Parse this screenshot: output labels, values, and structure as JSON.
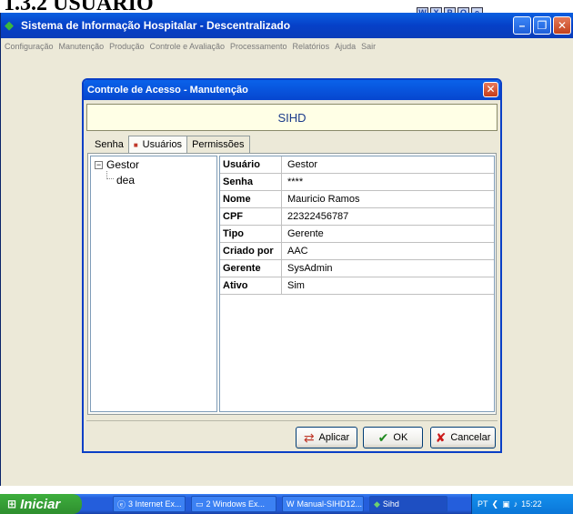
{
  "doc_heading": "1.3.2 USUÁRIO",
  "top_icons": [
    "W",
    "X",
    "P",
    "O",
    "e"
  ],
  "app": {
    "title": "Sistema de Informação Hospitalar - Descentralizado",
    "menu": [
      "Configuração",
      "Manutenção",
      "Produção",
      "Controle e Avaliação",
      "Processamento",
      "Relatórios",
      "Ajuda",
      "Sair"
    ]
  },
  "dialog": {
    "title": "Controle de Acesso - Manutenção",
    "banner": "SIHD",
    "tabs": [
      "Senha",
      "Usuários",
      "Permissões"
    ],
    "active_tab": "Usuários",
    "tree": {
      "root": "Gestor",
      "children": [
        "dea"
      ]
    },
    "properties": [
      {
        "key": "Usuário",
        "value": "Gestor"
      },
      {
        "key": "Senha",
        "value": "****"
      },
      {
        "key": "Nome",
        "value": "Mauricio Ramos"
      },
      {
        "key": "CPF",
        "value": "22322456787"
      },
      {
        "key": "Tipo",
        "value": "Gerente"
      },
      {
        "key": "Criado por",
        "value": "AAC"
      },
      {
        "key": "Gerente",
        "value": "SysAdmin"
      },
      {
        "key": "Ativo",
        "value": "Sim"
      }
    ],
    "buttons": {
      "apply": "Aplicar",
      "ok": "OK",
      "cancel": "Cancelar"
    }
  },
  "taskbar": {
    "start": "Iniciar",
    "items": [
      "3 Internet Ex...",
      "2 Windows Ex...",
      "Manual-SIHD12...",
      "Sihd"
    ],
    "tray_lang": "PT",
    "clock": "15:22"
  },
  "colors": {
    "xp_blue": "#0a5fe0",
    "banner_bg": "#ffffe6",
    "banner_text": "#1a3a8a",
    "start_green": "#3dae3d"
  }
}
